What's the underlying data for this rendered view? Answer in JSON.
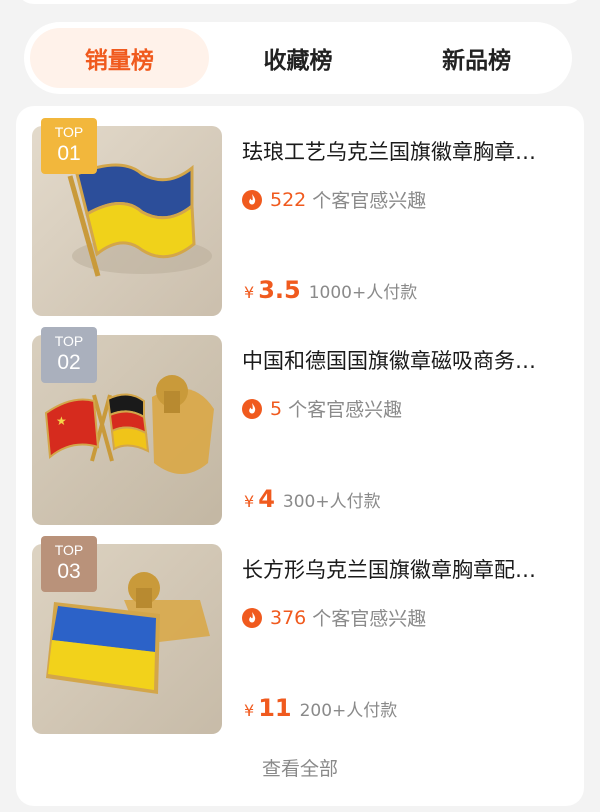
{
  "tabs": [
    {
      "label": "销量榜",
      "active": true
    },
    {
      "label": "收藏榜",
      "active": false
    },
    {
      "label": "新品榜",
      "active": false
    }
  ],
  "products": [
    {
      "rank_top": "TOP",
      "rank_num": "01",
      "title": "珐琅工艺乌克兰国旗徽章胸章…",
      "interest_count": "522",
      "interest_text": "个客官感兴趣",
      "currency": "¥",
      "price": "3.5",
      "paid": "1000+人付款",
      "image": "ukraine-waving-flag-pin"
    },
    {
      "rank_top": "TOP",
      "rank_num": "02",
      "title": "中国和德国国旗徽章磁吸商务…",
      "interest_count": "5",
      "interest_text": "个客官感兴趣",
      "currency": "¥",
      "price": "4",
      "paid": "300+人付款",
      "image": "china-germany-crossed-flags-pin"
    },
    {
      "rank_top": "TOP",
      "rank_num": "03",
      "title": "长方形乌克兰国旗徽章胸章配…",
      "interest_count": "376",
      "interest_text": "个客官感兴趣",
      "currency": "¥",
      "price": "11",
      "paid": "200+人付款",
      "image": "ukraine-rectangle-flag-pin"
    }
  ],
  "view_all": "查看全部",
  "colors": {
    "accent": "#f05a1e",
    "rank_gold": "#f2b73c",
    "rank_silver": "#aab0bd",
    "rank_bronze": "#b9927a"
  }
}
